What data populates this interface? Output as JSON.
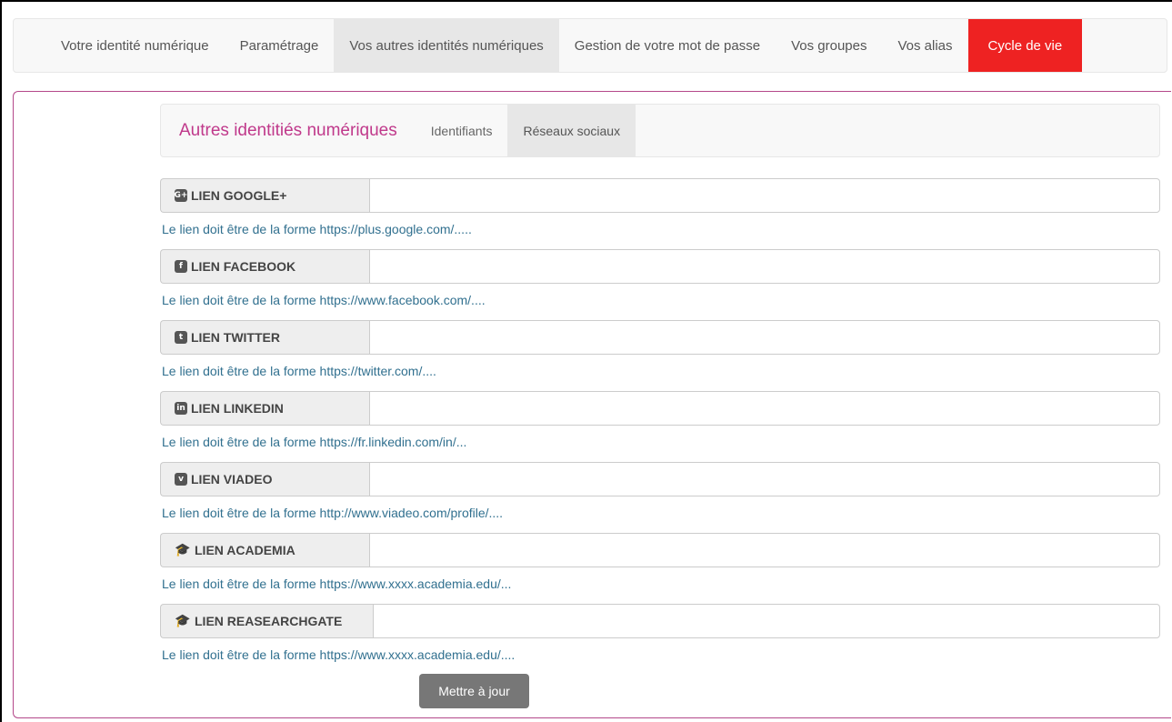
{
  "topnav": {
    "items": [
      {
        "label": "Votre identité numérique"
      },
      {
        "label": "Paramétrage"
      },
      {
        "label": "Vos autres identités numériques"
      },
      {
        "label": "Gestion de votre mot de passe"
      },
      {
        "label": "Vos groupes"
      },
      {
        "label": "Vos alias"
      },
      {
        "label": "Cycle de vie"
      }
    ],
    "active_index": 2,
    "danger_color": "#ee2222"
  },
  "subnav": {
    "brand": "Autres identitiés numériques",
    "items": [
      {
        "label": "Identifiants"
      },
      {
        "label": "Réseaux sociaux"
      }
    ],
    "brand_color": "#c0398b"
  },
  "fields": [
    {
      "icon": "google-plus-icon",
      "glyph": "G+",
      "label": "LIEN GOOGLE+",
      "value": "",
      "help": "Le lien doit être de la forme https://plus.google.com/....."
    },
    {
      "icon": "facebook-icon",
      "glyph": "f",
      "label": "LIEN FACEBOOK",
      "value": "",
      "help": "Le lien doit être de la forme https://www.facebook.com/...."
    },
    {
      "icon": "twitter-icon",
      "glyph": "t",
      "label": "LIEN TWITTER",
      "value": "",
      "help": "Le lien doit être de la forme https://twitter.com/...."
    },
    {
      "icon": "linkedin-icon",
      "glyph": "in",
      "label": "LIEN LINKEDIN",
      "value": "",
      "help": "Le lien doit être de la forme https://fr.linkedin.com/in/..."
    },
    {
      "icon": "viadeo-icon",
      "glyph": "v",
      "label": "LIEN VIADEO",
      "value": "",
      "help": "Le lien doit être de la forme http://www.viadeo.com/profile/...."
    },
    {
      "icon": "graduation-cap-icon",
      "glyph": "🎓",
      "label": "LIEN ACADEMIA",
      "value": "",
      "help": "Le lien doit être de la forme https://www.xxxx.academia.edu/..."
    },
    {
      "icon": "graduation-cap-icon",
      "glyph": "🎓",
      "label": "LIEN REASEARCHGATE",
      "value": "",
      "help": "Le lien doit être de la forme https://www.xxxx.academia.edu/...."
    }
  ],
  "submit_label": "Mettre à jour",
  "help_color": "#31708f",
  "panel_border_color": "#b4488a"
}
